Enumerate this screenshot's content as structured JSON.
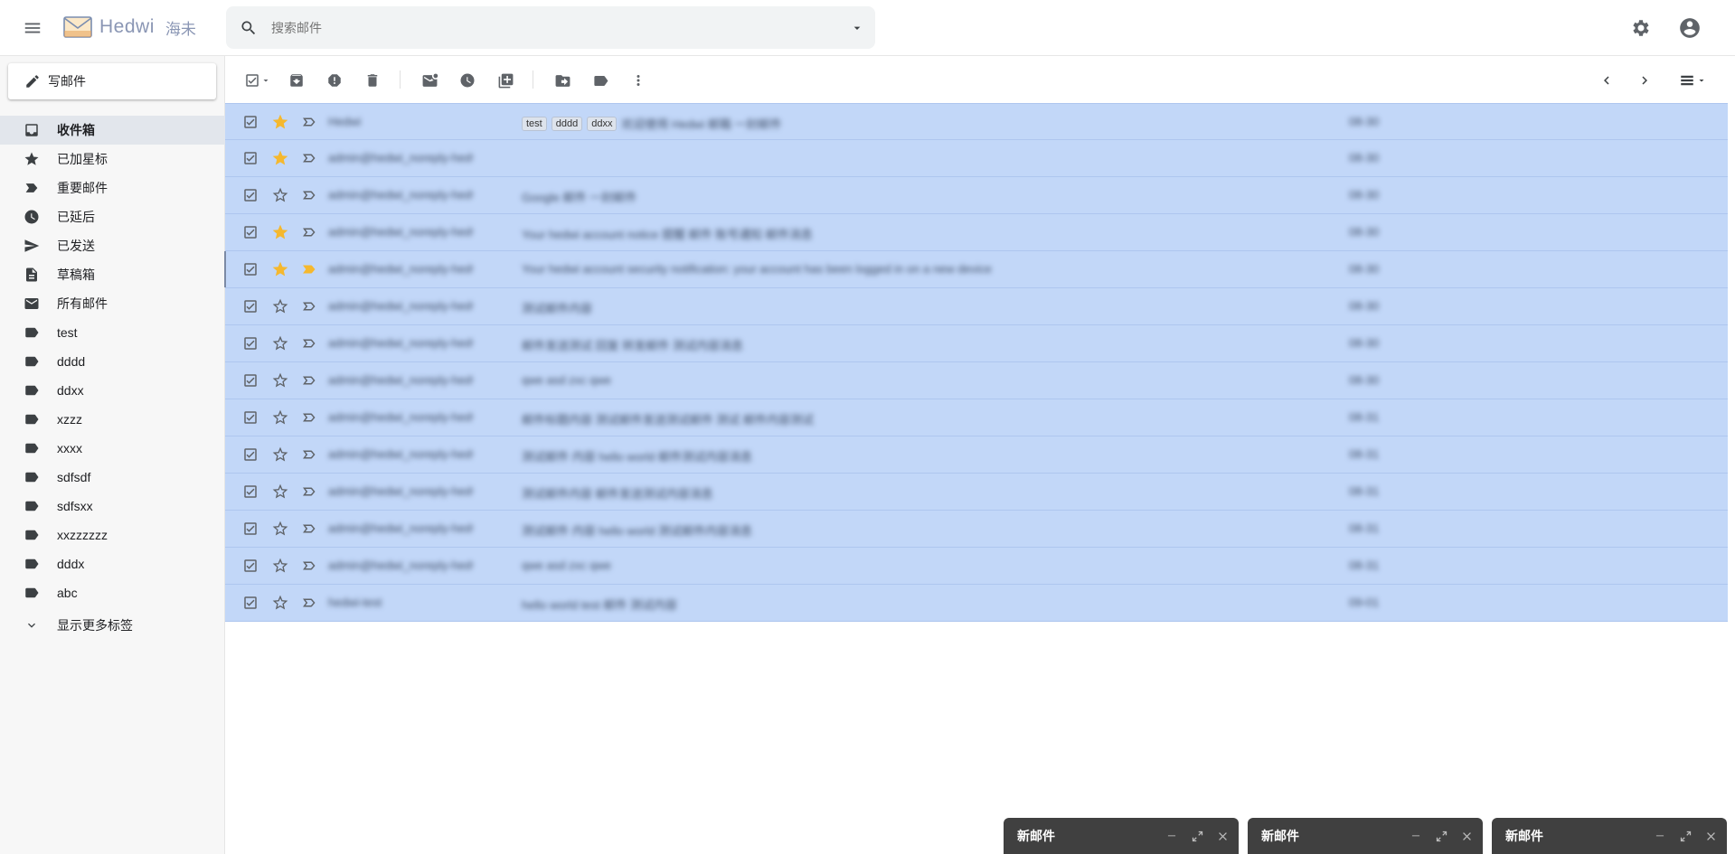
{
  "app": {
    "name": "Hedwi",
    "subname": "海未"
  },
  "search": {
    "placeholder": "搜索邮件",
    "value": ""
  },
  "sidebar": {
    "compose_label": "写邮件",
    "items": [
      {
        "label": "收件箱",
        "icon": "inbox-icon",
        "active": true
      },
      {
        "label": "已加星标",
        "icon": "star-icon"
      },
      {
        "label": "重要邮件",
        "icon": "important-icon"
      },
      {
        "label": "已延后",
        "icon": "clock-icon"
      },
      {
        "label": "已发送",
        "icon": "send-icon"
      },
      {
        "label": "草稿箱",
        "icon": "draft-icon"
      },
      {
        "label": "所有邮件",
        "icon": "mail-icon"
      },
      {
        "label": "test",
        "icon": "label-icon"
      },
      {
        "label": "dddd",
        "icon": "label-icon"
      },
      {
        "label": "ddxx",
        "icon": "label-icon"
      },
      {
        "label": "xzzz",
        "icon": "label-icon"
      },
      {
        "label": "xxxx",
        "icon": "label-icon"
      },
      {
        "label": "sdfsdf",
        "icon": "label-icon"
      },
      {
        "label": "sdfsxx",
        "icon": "label-icon"
      },
      {
        "label": "xxzzzzzz",
        "icon": "label-icon"
      },
      {
        "label": "dddx",
        "icon": "label-icon"
      },
      {
        "label": "abc",
        "icon": "label-icon"
      }
    ],
    "more_label": "显示更多标签"
  },
  "mail_list": {
    "rows": [
      {
        "starred": true,
        "important": false,
        "sender": "Hedwi",
        "tags": [
          "test",
          "dddd",
          "ddxx"
        ],
        "subject": "欢迎使用 Hedwi 邮箱 一封邮件",
        "date": "08-30"
      },
      {
        "starred": true,
        "important": false,
        "sender": "admin@hedwi_noreply-hedwi",
        "tags": [],
        "subject": "",
        "date": "08-30"
      },
      {
        "starred": false,
        "important": false,
        "sender": "admin@hedwi_noreply-hedwi",
        "tags": [],
        "subject": "Google 邮件 一封邮件",
        "date": "08-30"
      },
      {
        "starred": true,
        "important": false,
        "sender": "admin@hedwi_noreply-hedwi",
        "tags": [],
        "subject": "Your hedwi account notice 提醒 邮件 账号通知 邮件消息",
        "date": "08-30"
      },
      {
        "starred": true,
        "important": true,
        "sender": "admin@hedwi_noreply-hedwi",
        "tags": [],
        "subject": "Your hedwi account security notification: your account has been logged in on a new device",
        "date": "08-30"
      },
      {
        "starred": false,
        "important": false,
        "sender": "admin@hedwi_noreply-hedwi",
        "tags": [],
        "subject": "测试邮件内容",
        "date": "08-30"
      },
      {
        "starred": false,
        "important": false,
        "sender": "admin@hedwi_noreply-hedwi",
        "tags": [],
        "subject": "邮件发送测试 回复 转发邮件 测试内容消息",
        "date": "08-30"
      },
      {
        "starred": false,
        "important": false,
        "sender": "admin@hedwi_noreply-hedwi",
        "tags": [],
        "subject": "qwe asd zxc qwe",
        "date": "08-30"
      },
      {
        "starred": false,
        "important": false,
        "sender": "admin@hedwi_noreply-hedwi",
        "tags": [],
        "subject": "邮件标题内容 测试邮件发送测试邮件 测试 邮件内容测试",
        "date": "08-31"
      },
      {
        "starred": false,
        "important": false,
        "sender": "admin@hedwi_noreply-hedwi",
        "tags": [],
        "subject": "测试邮件 内容 hello world 邮件测试内容消息",
        "date": "08-31"
      },
      {
        "starred": false,
        "important": false,
        "sender": "admin@hedwi_noreply-hedwi",
        "tags": [],
        "subject": "测试邮件内容 邮件发送测试内容消息",
        "date": "08-31"
      },
      {
        "starred": false,
        "important": false,
        "sender": "admin@hedwi_noreply-hedwi",
        "tags": [],
        "subject": "测试邮件 内容 hello world 测试邮件内容消息",
        "date": "08-31"
      },
      {
        "starred": false,
        "important": false,
        "sender": "admin@hedwi_noreply-hedwi",
        "tags": [],
        "subject": "qwe asd zxc qwe",
        "date": "08-31"
      },
      {
        "starred": false,
        "important": false,
        "sender": "hedwi-test",
        "tags": [],
        "subject": "hello world test 邮件 测试内容",
        "date": "09-01"
      }
    ]
  },
  "compose_windows": [
    {
      "title": "新邮件"
    },
    {
      "title": "新邮件"
    },
    {
      "title": "新邮件"
    }
  ],
  "colors": {
    "selected_row": "#c2d7f8",
    "star": "#f5b82e",
    "compose_bar": "#404040"
  }
}
